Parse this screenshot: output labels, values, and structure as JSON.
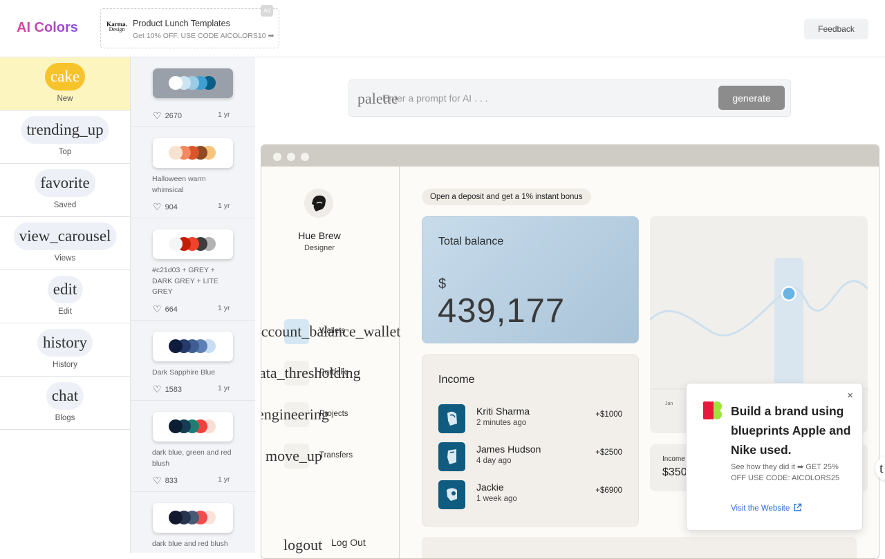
{
  "app": {
    "title": "AI Colors"
  },
  "ad": {
    "brand_top": "Karma.",
    "brand_bottom": "Design",
    "title": "Product Lunch Templates",
    "subtitle": "Get 10% OFF. USE CODE AICOLORS10 ➡",
    "badge": "Ad"
  },
  "header": {
    "feedback_label": "Feedback"
  },
  "nav": {
    "items": [
      {
        "icon": "cake",
        "label": "New"
      },
      {
        "icon": "trending_up",
        "label": "Top"
      },
      {
        "icon": "favorite",
        "label": "Saved"
      },
      {
        "icon": "view_carousel",
        "label": "Views"
      },
      {
        "icon": "edit",
        "label": "Edit"
      },
      {
        "icon": "history",
        "label": "History"
      },
      {
        "icon": "chat",
        "label": "Blogs"
      }
    ]
  },
  "palettes": [
    {
      "name": "",
      "likes": "2670",
      "age": "1 yr",
      "colors": [
        "#ffffff",
        "#cde4f3",
        "#9ccbe6",
        "#3f9fd1",
        "#0b5e86"
      ]
    },
    {
      "name": "Halloween warm whimsical",
      "likes": "904",
      "age": "1 yr",
      "colors": [
        "#f6e2cf",
        "#f5885e",
        "#d9552c",
        "#8f4a21",
        "#f7c47e"
      ]
    },
    {
      "name": "#c21d03 + GREY + DARK GREY + LITE GREY",
      "likes": "664",
      "age": "1 yr",
      "colors": [
        "#f5f5f5",
        "#c21d03",
        "#f0432a",
        "#3d3d3d",
        "#b3b3b3"
      ]
    },
    {
      "name": "Dark Sapphire Blue",
      "likes": "1583",
      "age": "1 yr",
      "colors": [
        "#0f1c3d",
        "#243b6b",
        "#3f5f94",
        "#5d7fb5",
        "#c8dcf3"
      ]
    },
    {
      "name": "dark blue, green and red blush",
      "likes": "833",
      "age": "1 yr",
      "colors": [
        "#0c1e33",
        "#173d56",
        "#1e7e74",
        "#f3403f",
        "#f7ddd3"
      ]
    },
    {
      "name": "dark blue and red blush",
      "likes": "",
      "age": "",
      "colors": [
        "#12192e",
        "#273450",
        "#4a5a74",
        "#f24b4e",
        "#fbe1d7"
      ]
    }
  ],
  "prompt": {
    "icon": "palette",
    "placeholder": "Enter a prompt for AI . . .",
    "generate_label": "generate"
  },
  "preview": {
    "user": {
      "name": "Hue Brew",
      "role": "Designer"
    },
    "menu": [
      {
        "icon": "account_balance_wallet",
        "label": "Wallets"
      },
      {
        "icon": "data_thresholding",
        "label": "Portfolio"
      },
      {
        "icon": "engineering",
        "label": "Projects"
      },
      {
        "icon": "move_up",
        "label": "Transfers"
      }
    ],
    "logout": {
      "icon": "logout",
      "label": "Log Out"
    },
    "promo_pill": "Open a deposit and get a 1% instant bonus",
    "balance": {
      "title": "Total balance",
      "currency": "$",
      "value": "439,177"
    },
    "chart": {
      "first_label": "Jan"
    },
    "income": {
      "title": "Income",
      "transactions": [
        {
          "name": "Kriti Sharma",
          "time": "2 minutes ago",
          "amount": "+$1000"
        },
        {
          "name": "James Hudson",
          "time": "4 day ago",
          "amount": "+$2500"
        },
        {
          "name": "Jackie",
          "time": "1 week ago",
          "amount": "+$6900"
        }
      ]
    },
    "income_mini": {
      "label": "Income",
      "value": "$350"
    },
    "edge_icon": "t"
  },
  "popup": {
    "title": "Build a brand using blueprints Apple and Nike used.",
    "description": "See how they did it ➡ GET 25% OFF USE CODE: AICOLORS25",
    "link": "Visit the Website",
    "close": "×"
  }
}
